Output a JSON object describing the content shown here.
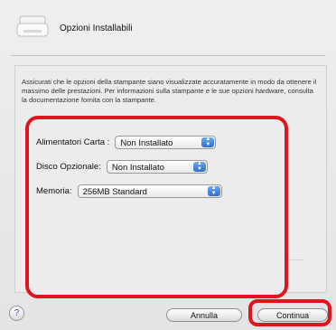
{
  "dialog": {
    "title": "Opzioni Installabili",
    "description": "Assicurati che le opzioni della stampante siano visualizzate accuratamente in modo da ottenere il massimo delle prestazioni.  Per informazioni sulla stampante e le sue opzioni hardware, consulta la documentazione fornita con la stampante."
  },
  "options": [
    {
      "label": "Alimentatori Carta :",
      "value": "Non Installato"
    },
    {
      "label": "Disco Opzionale:",
      "value": "Non Installato"
    },
    {
      "label": "Memoria:",
      "value": "256MB Standard"
    }
  ],
  "buttons": {
    "help": "?",
    "cancel": "Annulla",
    "continue": "Continua"
  },
  "colors": {
    "highlight": "#e0141e",
    "popup_arrow": "#2f6ed0"
  }
}
